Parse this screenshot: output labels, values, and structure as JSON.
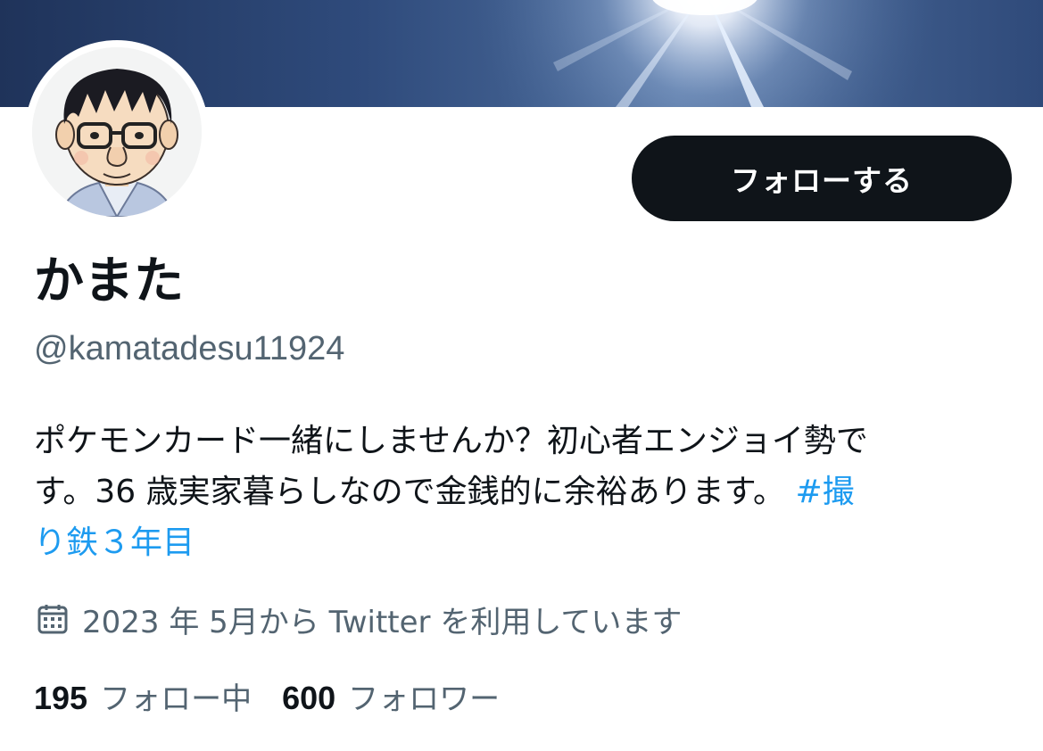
{
  "profile": {
    "display_name": "かまた",
    "handle": "@kamatadesu11924",
    "follow_button_label": "フォローする",
    "bio_lines": [
      "ポケモンカード一緒にしませんか？初心者エンジョイ勢で",
      "す。36 歳実家暮らしなので金銭的に余裕あります。 ",
      "り鉄３年目"
    ],
    "hashtag_part1": "#撮",
    "joined_text": "2023 年 5月から Twitter を利用しています",
    "following_count": "195",
    "following_label": "フォロー中",
    "followers_count": "600",
    "followers_label": "フォロワー"
  },
  "icons": {
    "calendar": "calendar-icon"
  },
  "colors": {
    "text_primary": "#0f1419",
    "text_secondary": "#536471",
    "link": "#1d9bf0",
    "button_bg": "#0f1419",
    "banner_sky": "#3e5a88"
  }
}
